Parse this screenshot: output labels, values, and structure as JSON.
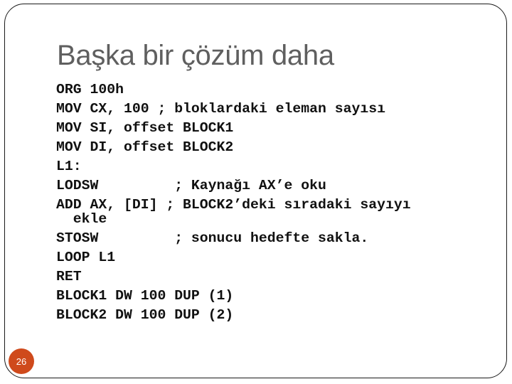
{
  "slide": {
    "title": "Başka bir çözüm daha",
    "code_lines": [
      "ORG 100h",
      "MOV CX, 100 ; bloklardaki eleman sayısı",
      "MOV SI, offset BLOCK1",
      "MOV DI, offset BLOCK2",
      "L1:",
      "LODSW         ; Kaynağı AX’e oku",
      "ADD AX, [DI] ; BLOCK2’deki sıradaki sayıyı",
      "  ekle",
      "STOSW         ; sonucu hedefte sakla.",
      "LOOP L1",
      "RET",
      "BLOCK1 DW 100 DUP (1)",
      "BLOCK2 DW 100 DUP (2)"
    ],
    "page_number": "26",
    "colors": {
      "title": "#5f5f5f",
      "badge": "#cf4a1c",
      "text": "#111111"
    }
  }
}
